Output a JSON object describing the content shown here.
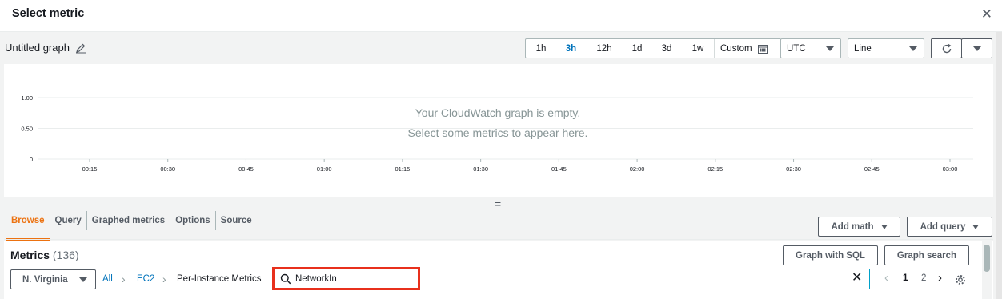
{
  "modal": {
    "title": "Select metric",
    "close_icon": "close-icon"
  },
  "graph": {
    "title": "Untitled graph",
    "time_ranges": [
      "1h",
      "3h",
      "12h",
      "1d",
      "3d",
      "1w"
    ],
    "active_range": "3h",
    "custom_label": "Custom",
    "timezone": "UTC",
    "chart_type": "Line",
    "empty_title": "Your CloudWatch graph is empty.",
    "empty_subtitle": "Select some metrics to appear here."
  },
  "chart_data": {
    "type": "line",
    "y_ticks": [
      "1.00",
      "0.50",
      "0"
    ],
    "ylim": [
      0,
      1
    ],
    "x_ticks": [
      "00:15",
      "00:30",
      "00:45",
      "01:00",
      "01:15",
      "01:30",
      "01:45",
      "02:00",
      "02:15",
      "02:30",
      "02:45",
      "03:00"
    ],
    "series": [],
    "grid": true
  },
  "tabs": [
    {
      "label": "Browse",
      "active": true
    },
    {
      "label": "Query",
      "active": false
    },
    {
      "label": "Graphed metrics",
      "active": false
    },
    {
      "label": "Options",
      "active": false
    },
    {
      "label": "Source",
      "active": false
    }
  ],
  "actions": {
    "add_math": "Add math",
    "add_query": "Add query"
  },
  "metrics": {
    "title": "Metrics",
    "count": "(136)",
    "graph_with_sql": "Graph with SQL",
    "graph_search": "Graph search",
    "region": "N. Virginia",
    "breadcrumb": [
      "All",
      "EC2",
      "Per-Instance Metrics"
    ],
    "search_value": "NetworkIn",
    "pages": [
      "1",
      "2"
    ],
    "current_page": "1"
  },
  "colors": {
    "accent": "#ec7211",
    "link": "#0073bb",
    "highlight": "#e8301c",
    "focus": "#00a1c9"
  }
}
